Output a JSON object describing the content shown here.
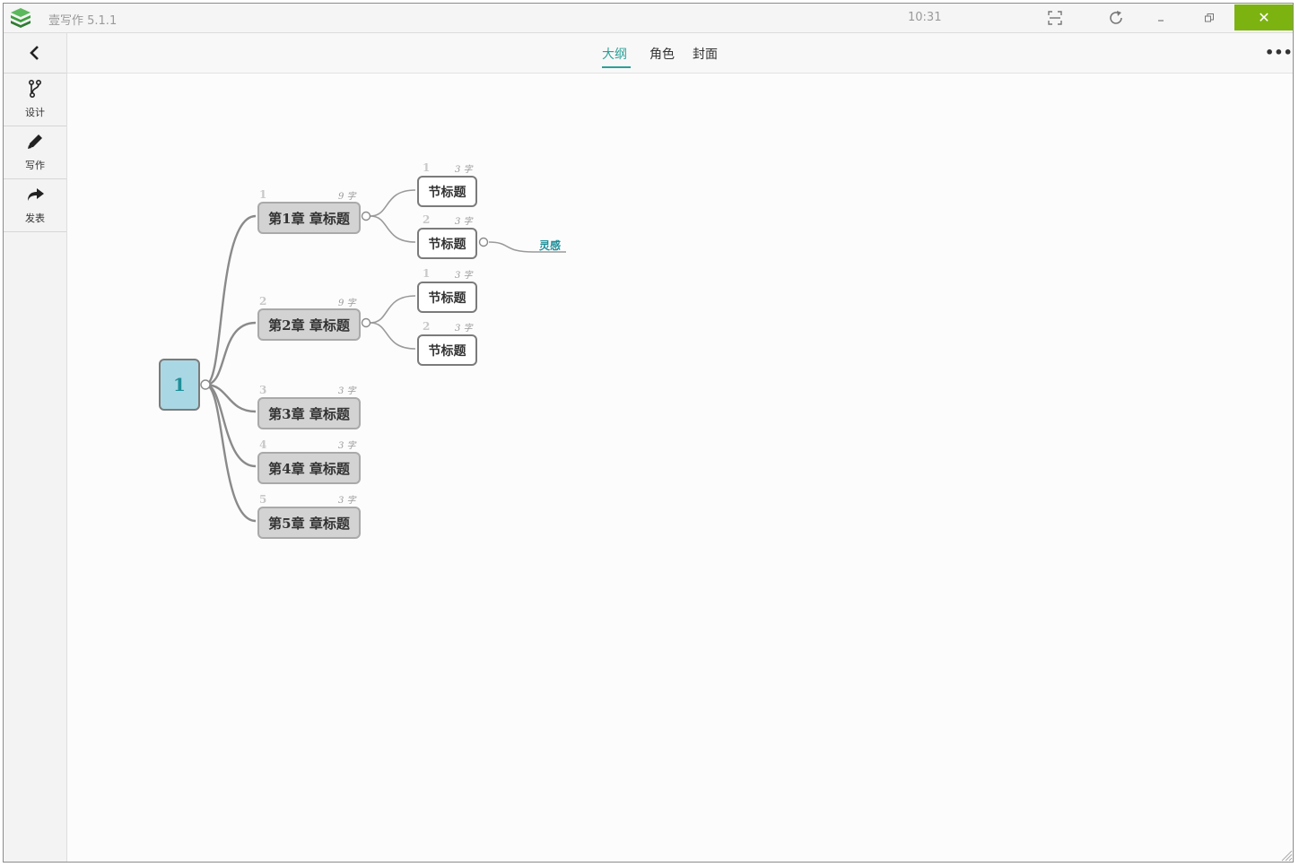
{
  "titlebar": {
    "app_title": "壹写作  5.1.1",
    "clock": "10:31",
    "close_glyph": "✕",
    "icons": [
      "app-logo-icon",
      "screen-capture-icon",
      "refresh-icon",
      "minimize-icon",
      "restore-icon",
      "close-icon"
    ]
  },
  "sidebar": {
    "items": [
      {
        "label": "设计",
        "icon": "branch-icon"
      },
      {
        "label": "写作",
        "icon": "pencil-icon"
      },
      {
        "label": "发表",
        "icon": "share-arrow-icon"
      }
    ]
  },
  "topnav": {
    "tabs": [
      {
        "label": "大纲",
        "active": true
      },
      {
        "label": "角色",
        "active": false
      },
      {
        "label": "封面",
        "active": false
      }
    ],
    "more_glyph": "•••"
  },
  "mindmap": {
    "root": {
      "label": "1"
    },
    "chapters": [
      {
        "index": "1",
        "count": "9 字",
        "label": "第1章 章标题",
        "sections": [
          {
            "index": "1",
            "count": "3 字",
            "label": "节标题"
          },
          {
            "index": "2",
            "count": "3 字",
            "label": "节标题",
            "note": "灵感"
          }
        ]
      },
      {
        "index": "2",
        "count": "9 字",
        "label": "第2章 章标题",
        "sections": [
          {
            "index": "1",
            "count": "3 字",
            "label": "节标题"
          },
          {
            "index": "2",
            "count": "3 字",
            "label": "节标题"
          }
        ]
      },
      {
        "index": "3",
        "count": "3 字",
        "label": "第3章 章标题",
        "sections": []
      },
      {
        "index": "4",
        "count": "3 字",
        "label": "第4章 章标题",
        "sections": []
      },
      {
        "index": "5",
        "count": "3 字",
        "label": "第5章 章标题",
        "sections": []
      }
    ]
  },
  "colors": {
    "accent": "#2aa198",
    "close_button": "#7db311",
    "root_fill": "#a9d8e4",
    "chapter_fill": "#d3d3d3",
    "connector": "#8a8a8a"
  }
}
